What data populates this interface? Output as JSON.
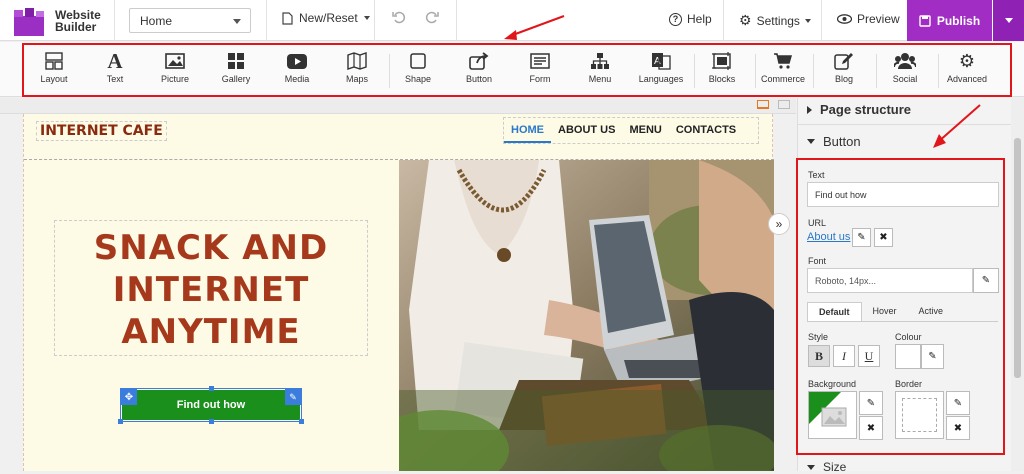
{
  "app": {
    "name_line1": "Website",
    "name_line2": "Builder"
  },
  "topbar": {
    "page_select": "Home",
    "new_reset": "New/Reset",
    "help": "Help",
    "settings": "Settings",
    "preview": "Preview",
    "publish": "Publish"
  },
  "toolbar": {
    "items": [
      {
        "label": "Layout",
        "icon": "layout-icon"
      },
      {
        "label": "Text",
        "icon": "text-icon"
      },
      {
        "label": "Picture",
        "icon": "picture-icon"
      },
      {
        "label": "Gallery",
        "icon": "gallery-icon"
      },
      {
        "label": "Media",
        "icon": "media-icon"
      },
      {
        "label": "Maps",
        "icon": "maps-icon"
      },
      {
        "label": "Shape",
        "icon": "shape-icon"
      },
      {
        "label": "Button",
        "icon": "button-icon"
      },
      {
        "label": "Form",
        "icon": "form-icon"
      },
      {
        "label": "Menu",
        "icon": "menu-icon"
      },
      {
        "label": "Languages",
        "icon": "languages-icon"
      },
      {
        "label": "Blocks",
        "icon": "blocks-icon"
      },
      {
        "label": "Commerce",
        "icon": "commerce-icon"
      },
      {
        "label": "Blog",
        "icon": "blog-icon"
      },
      {
        "label": "Social",
        "icon": "social-icon"
      },
      {
        "label": "Advanced",
        "icon": "advanced-icon"
      }
    ]
  },
  "site": {
    "logo": "INTERNET CAFE",
    "nav": [
      "HOME",
      "ABOUT US",
      "MENU",
      "CONTACTS"
    ],
    "headline": [
      "SNACK AND",
      "INTERNET",
      "ANYTIME"
    ],
    "button_label": "Find out how"
  },
  "panel": {
    "page_structure": "Page structure",
    "button_section": "Button",
    "text_label": "Text",
    "text_value": "Find out how",
    "url_label": "URL",
    "url_value": "About us",
    "font_label": "Font",
    "font_value": "Roboto, 14px...",
    "tabs": [
      "Default",
      "Hover",
      "Active"
    ],
    "style_label": "Style",
    "colour_label": "Colour",
    "background_label": "Background",
    "border_label": "Border",
    "size_section": "Size"
  },
  "colors": {
    "accent": "#a12dc4",
    "button_green": "#1b8f1b",
    "headline": "#a6381c",
    "highlight_red": "#e0161b",
    "link": "#2a78c8"
  }
}
